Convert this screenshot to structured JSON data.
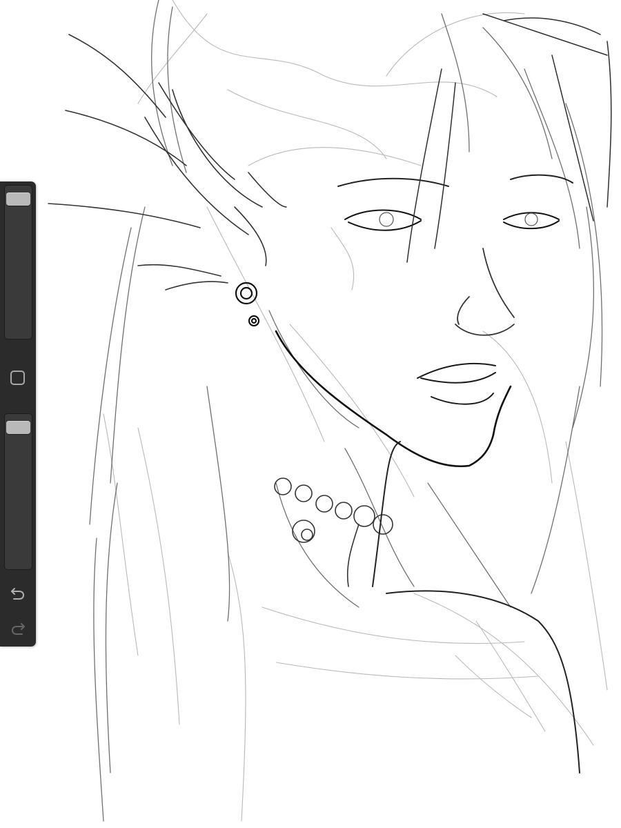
{
  "app": {
    "canvas_content": "sketch",
    "accent_color": "#2b2b2b"
  },
  "sidebar": {
    "brush_size": {
      "value_fraction": 0.97
    },
    "modify_button": {
      "icon": "square-icon"
    },
    "brush_opacity": {
      "value_fraction": 0.97
    },
    "undo": {
      "icon": "undo-icon"
    },
    "redo": {
      "icon": "redo-icon",
      "enabled": false
    }
  }
}
